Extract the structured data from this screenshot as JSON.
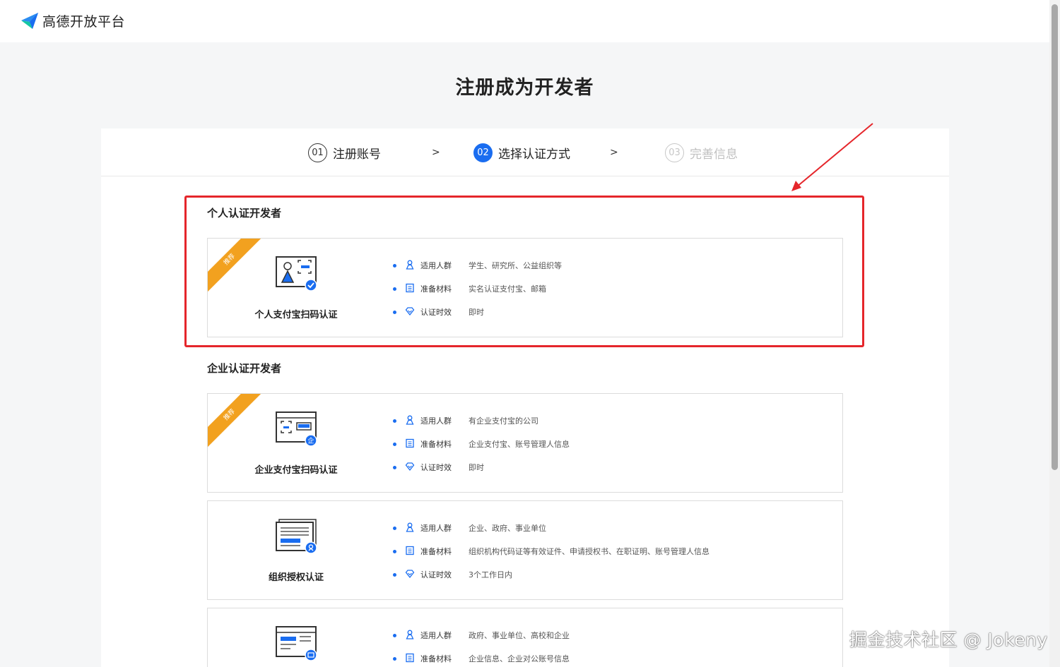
{
  "header": {
    "logo_text": "高德开放平台"
  },
  "page_title": "注册成为开发者",
  "steps": [
    {
      "num": "01",
      "label": "注册账号",
      "state": "done"
    },
    {
      "num": "02",
      "label": "选择认证方式",
      "state": "active"
    },
    {
      "num": "03",
      "label": "完善信息",
      "state": "disabled"
    }
  ],
  "step_separator": ">",
  "sections": {
    "personal": "个人认证开发者",
    "enterprise": "企业认证开发者"
  },
  "labels": {
    "audience": "适用人群",
    "materials": "准备材料",
    "time": "认证时效",
    "recommended": "推荐"
  },
  "cards": [
    {
      "name": "个人支付宝扫码认证",
      "audience": "学生、研究所、公益组织等",
      "materials": "实名认证支付宝、邮箱",
      "time": "即时"
    },
    {
      "name": "企业支付宝扫码认证",
      "audience": "有企业支付宝的公司",
      "materials": "企业支付宝、账号管理人信息",
      "time": "即时"
    },
    {
      "name": "组织授权认证",
      "audience": "企业、政府、事业单位",
      "materials": "组织机构代码证等有效证件、申请授权书、在职证明、账号管理人信息",
      "time": "3个工作日内"
    },
    {
      "name": "",
      "audience": "政府、事业单位、高校和企业",
      "materials": "企业信息、企业对公账号信息",
      "time": ""
    }
  ],
  "watermark": "掘金技术社区 @ Jokeny",
  "colors": {
    "primary": "#1a6df0",
    "ribbon": "#f2a11f",
    "highlight": "#e5262b"
  }
}
